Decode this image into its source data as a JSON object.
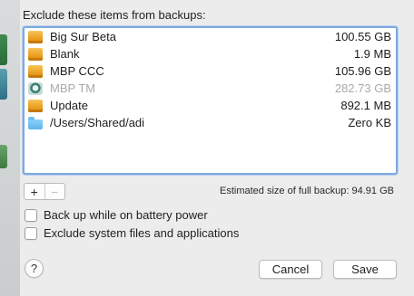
{
  "dialog": {
    "heading": "Exclude these items from backups:",
    "items": [
      {
        "name": "Big Sur Beta",
        "size": "100.55 GB",
        "icon": "drive-icon",
        "dimmed": false
      },
      {
        "name": "Blank",
        "size": "1.9 MB",
        "icon": "drive-icon",
        "dimmed": false
      },
      {
        "name": "MBP CCC",
        "size": "105.96 GB",
        "icon": "drive-icon",
        "dimmed": false
      },
      {
        "name": "MBP TM",
        "size": "282.73 GB",
        "icon": "time-machine-icon",
        "dimmed": true
      },
      {
        "name": "Update",
        "size": "892.1 MB",
        "icon": "drive-icon",
        "dimmed": false
      },
      {
        "name": "/Users/Shared/adi",
        "size": "Zero KB",
        "icon": "folder-icon",
        "dimmed": false
      }
    ],
    "add_label": "+",
    "remove_label": "−",
    "estimate": "Estimated size of full backup: 94.91 GB",
    "options": {
      "battery_label": "Back up while on battery power",
      "battery_checked": false,
      "system_label": "Exclude system files and applications",
      "system_checked": false
    },
    "help_label": "?",
    "cancel_label": "Cancel",
    "save_label": "Save"
  }
}
